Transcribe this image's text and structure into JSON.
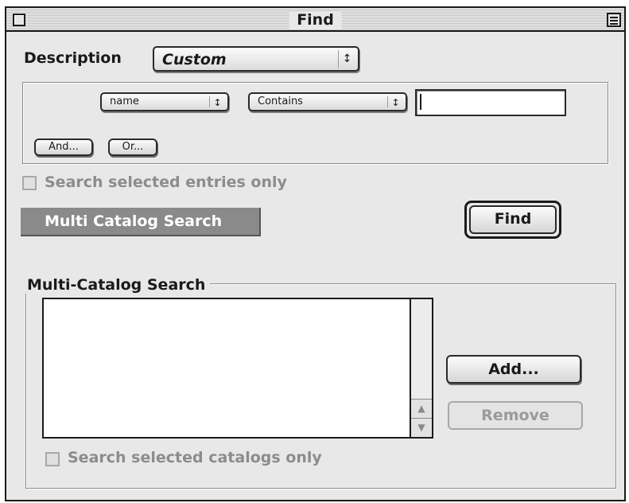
{
  "window": {
    "title": "Find"
  },
  "description": {
    "label": "Description",
    "value": "Custom"
  },
  "criteria": {
    "field_value": "name",
    "operator_value": "Contains",
    "search_value": "",
    "and_label": "And...",
    "or_label": "Or..."
  },
  "search_selected_entries": {
    "label": "Search selected entries only",
    "checked": false
  },
  "multi_catalog_banner": "Multi Catalog Search",
  "find_button": "Find",
  "multi_catalog_group": {
    "title": "Multi-Catalog Search",
    "catalogs": [],
    "add_label": "Add...",
    "remove_label": "Remove",
    "search_selected_catalogs": {
      "label": "Search selected catalogs only",
      "checked": false
    }
  },
  "colors": {
    "window_bg": "#e8e8e8",
    "banner_bg": "#8a8a8a",
    "disabled_text": "#8c8c8c"
  },
  "icons": {
    "close": "close-box-icon",
    "zoom": "zoom-box-icon",
    "popup_arrows": "up-down-arrows-icon",
    "scroll_up": "scroll-up-arrow-icon",
    "scroll_down": "scroll-down-arrow-icon"
  }
}
